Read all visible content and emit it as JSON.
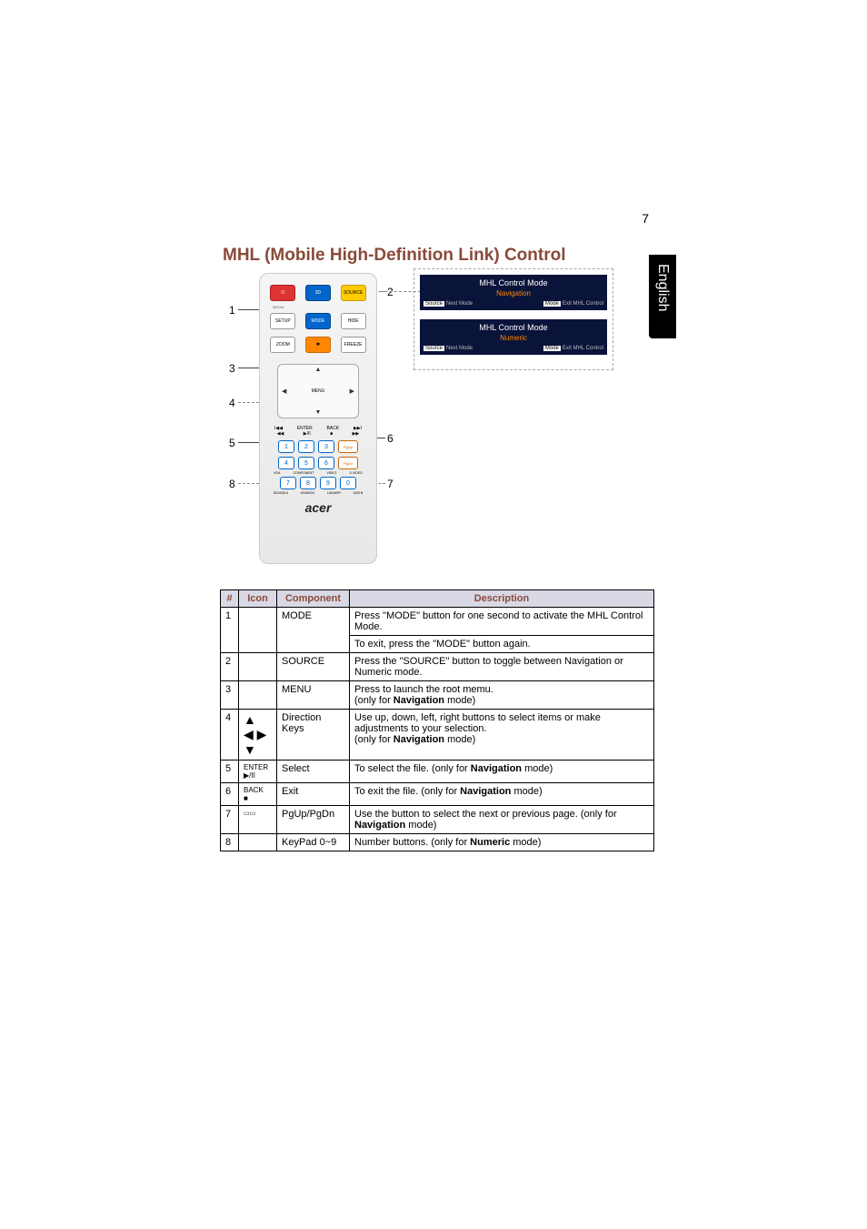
{
  "page_number": "7",
  "language_tab": "English",
  "title": "MHL (Mobile High-Definition Link) Control",
  "callouts": {
    "c1": "1",
    "c2": "2",
    "c3": "3",
    "c4": "4",
    "c5": "5",
    "c6": "6",
    "c7": "7",
    "c8": "8"
  },
  "remote": {
    "btn_mode": "MODE",
    "btn_hide": "HIDE",
    "btn_setup": "SETUP",
    "btn_zoom": "ZOOM",
    "btn_freeze": "FREEZE",
    "btn_source": "SOURCE",
    "media_label": "MEDIA",
    "menu_label": "MENU",
    "enter_label": "ENTER",
    "back_label": "BACK",
    "enter_sym": "▶/II",
    "back_sym": "■",
    "prev_sym": "I◀◀",
    "next_sym": "▶▶I",
    "pgup": "PgUp",
    "pgdn": "PgDn",
    "keys": {
      "k1": "1",
      "k2": "2",
      "k3": "3",
      "k4": "4",
      "k5": "5",
      "k6": "6",
      "k7": "7",
      "k8": "8",
      "k9": "9",
      "k0": "0"
    },
    "sublabels": {
      "vga": "VGA",
      "component": "COMPONENT",
      "video": "VIDEO",
      "svideo": "S-VIDEO",
      "sd": "SD/USB A",
      "hdmi": "HDMI/DVI",
      "lan": "LAN/WIFI",
      "usbb": "USB B"
    },
    "brand": "acer"
  },
  "osd": {
    "title": "MHL Control Mode",
    "nav": "Navigation",
    "numeric": "Numeric",
    "src_key": "Source",
    "mode_key": "Mode",
    "next_mode": "Next Mode",
    "exit": "Exit MHL Control"
  },
  "table": {
    "headers": {
      "num": "#",
      "icon": "Icon",
      "component": "Component",
      "description": "Description"
    },
    "rows": [
      {
        "num": "1",
        "icon": "",
        "component": "MODE",
        "desc_a": "Press \"MODE\" button for one second to activate the MHL Control Mode.",
        "desc_b": "To exit, press the \"MODE\" button again."
      },
      {
        "num": "2",
        "icon": "",
        "component": "SOURCE",
        "desc": "Press the \"SOURCE\" button to toggle between Navigation or Numeric mode."
      },
      {
        "num": "3",
        "icon": "",
        "component": "MENU",
        "desc_a": "Press to launch the root memu.",
        "desc_b": "(only for ",
        "desc_b_bold": "Navigation",
        "desc_b_end": " mode)"
      },
      {
        "num": "4",
        "icon": "dpad",
        "component": "Direction Keys",
        "desc_a": "Use up, down, left, right buttons to select items or make adjustments to your selection.",
        "desc_b": "(only for ",
        "desc_b_bold": "Navigation",
        "desc_b_end": " mode)"
      },
      {
        "num": "5",
        "icon_a": "ENTER",
        "icon_b": "▶/II",
        "component": "Select",
        "desc": "To select the file. (only for ",
        "desc_bold": "Navigation",
        "desc_end": " mode)"
      },
      {
        "num": "6",
        "icon_a": "BACK",
        "icon_b": "■",
        "component": "Exit",
        "desc": "To exit the file. (only for ",
        "desc_bold": "Navigation",
        "desc_end": " mode)"
      },
      {
        "num": "7",
        "icon": "pgbtns",
        "component": "PgUp/PgDn",
        "desc_a": "Use the button to select the next or previous page. (only for ",
        "desc_bold": "Navigation",
        "desc_end": " mode)"
      },
      {
        "num": "8",
        "icon": "",
        "component": "KeyPad 0~9",
        "desc": "Number buttons. (only for ",
        "desc_bold": "Numeric",
        "desc_end": " mode)"
      }
    ]
  }
}
